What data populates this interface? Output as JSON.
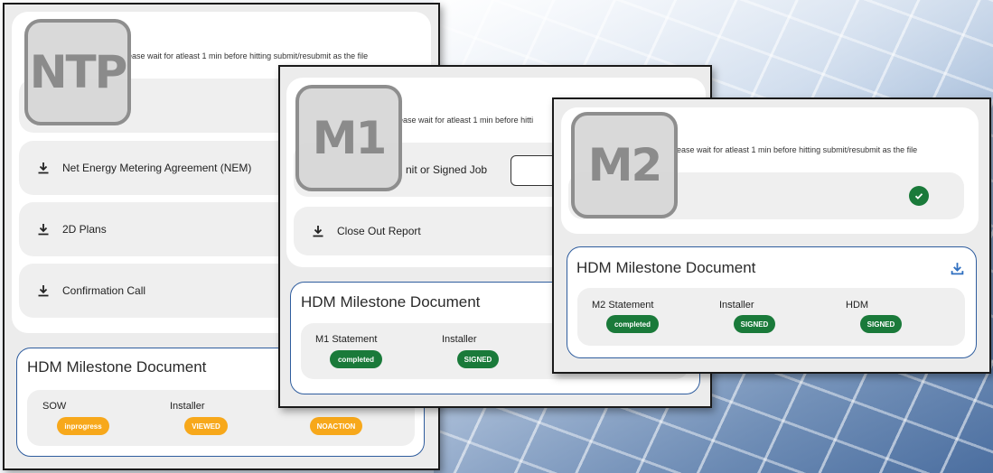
{
  "notice_text": "ease wait for atleast 1 min before hitting submit/resubmit as the file",
  "ntp": {
    "badge": "NTP",
    "docs": [
      {
        "label": "Net Energy Metering Agreement (NEM)"
      },
      {
        "label": "2D Plans"
      },
      {
        "label": "Confirmation Call"
      }
    ],
    "milestone": {
      "title": "HDM Milestone Document",
      "items": [
        {
          "label": "SOW",
          "status": "inprogress"
        },
        {
          "label": "Installer",
          "status": "VIEWED"
        },
        {
          "label": "",
          "status": "NOACTION"
        }
      ]
    }
  },
  "m1": {
    "badge": "M1",
    "notice_text": "ease wait for atleast 1 min before hitti",
    "doc_partial": "nit or Signed Job",
    "docs": [
      {
        "label": "Close Out Report"
      }
    ],
    "milestone": {
      "title": "HDM Milestone Document",
      "items": [
        {
          "label": "M1 Statement",
          "status": "completed"
        },
        {
          "label": "Installer",
          "status": "SIGNED"
        }
      ]
    }
  },
  "m2": {
    "badge": "M2",
    "milestone": {
      "title": "HDM Milestone Document",
      "items": [
        {
          "label": "M2 Statement",
          "status": "completed"
        },
        {
          "label": "Installer",
          "status": "SIGNED"
        },
        {
          "label": "HDM",
          "status": "SIGNED"
        }
      ]
    }
  },
  "colors": {
    "accent_blue": "#2f5d9e",
    "status_green": "#1a7a3a",
    "status_orange": "#f7a81b",
    "badge_gray": "#8b8b8b"
  }
}
